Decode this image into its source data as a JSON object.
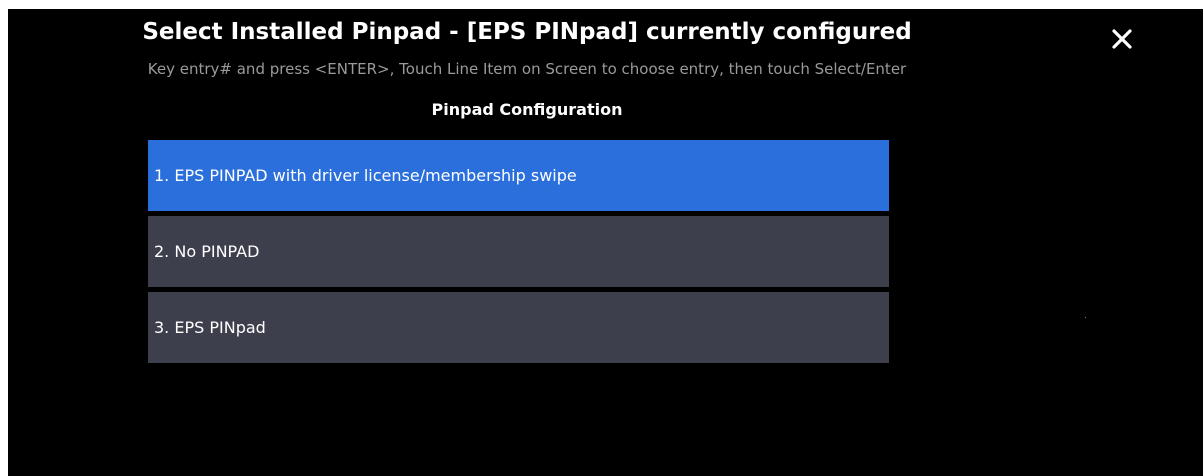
{
  "dialog": {
    "title": "Select Installed Pinpad - [EPS PINpad] currently configured",
    "instructions": "Key entry# and press <ENTER>, Touch Line Item on Screen to choose entry, then touch Select/Enter",
    "list_heading": "Pinpad Configuration",
    "close_icon": "close-icon",
    "options": [
      {
        "label": "1. EPS PINPAD with driver license/membership swipe",
        "selected": true
      },
      {
        "label": "2. No PINPAD",
        "selected": false
      },
      {
        "label": "3. EPS PINpad",
        "selected": false
      }
    ]
  },
  "colors": {
    "background": "#000000",
    "option_background": "#3e3f4d",
    "selected_background": "#2a6fdc",
    "instruction_text": "#9a9a9a",
    "text": "#ffffff"
  }
}
